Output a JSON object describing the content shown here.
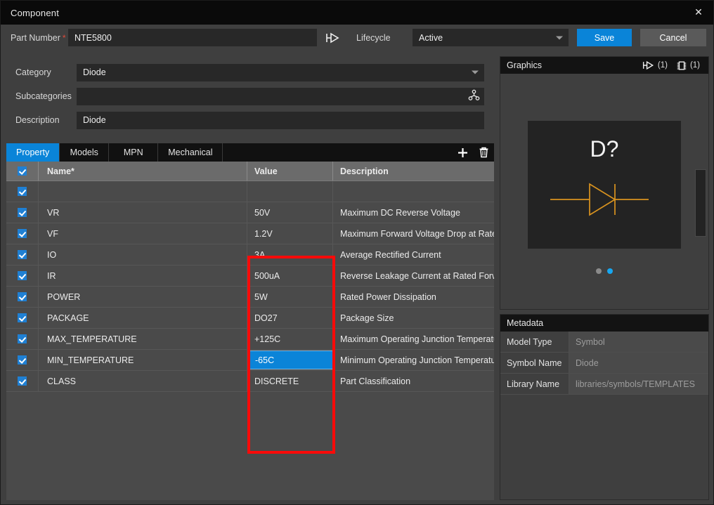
{
  "window": {
    "title": "Component",
    "close_label": "✕"
  },
  "header": {
    "part_number_label": "Part Number",
    "part_number_required": "*",
    "part_number_value": "NTE5800",
    "pin_icon": "pin-symbol-icon",
    "lifecycle_label": "Lifecycle",
    "lifecycle_value": "Active",
    "save_label": "Save",
    "cancel_label": "Cancel",
    "accent_color": "#0a84d8"
  },
  "form": {
    "category_label": "Category",
    "category_value": "Diode",
    "subcategories_label": "Subcategories",
    "subcategories_value": "",
    "subcategories_icon": "hierarchy-tree-icon",
    "description_label": "Description",
    "description_value": "Diode"
  },
  "tabs": {
    "items": [
      {
        "label": "Property",
        "active": true
      },
      {
        "label": "Models",
        "active": false
      },
      {
        "label": "MPN",
        "active": false
      },
      {
        "label": "Mechanical",
        "active": false
      }
    ],
    "add_icon": "plus-icon",
    "delete_icon": "trash-icon"
  },
  "table": {
    "columns": [
      "Name*",
      "Value",
      "Description"
    ],
    "header_checked": true,
    "rows": [
      {
        "checked": true,
        "name": "",
        "value": "",
        "description": "",
        "selected": false
      },
      {
        "checked": true,
        "name": "VR",
        "value": "50V",
        "description": "Maximum DC Reverse Voltage",
        "selected": false
      },
      {
        "checked": true,
        "name": "VF",
        "value": "1.2V",
        "description": "Maximum Forward Voltage Drop at Rated Current",
        "selected": false
      },
      {
        "checked": true,
        "name": "IO",
        "value": "3A",
        "description": "Average Rectified Current",
        "selected": false
      },
      {
        "checked": true,
        "name": "IR",
        "value": "500uA",
        "description": "Reverse Leakage Current at Rated Forward Voltage",
        "selected": false
      },
      {
        "checked": true,
        "name": "POWER",
        "value": "5W",
        "description": "Rated Power Dissipation",
        "selected": false
      },
      {
        "checked": true,
        "name": "PACKAGE",
        "value": "DO27",
        "description": "Package Size",
        "selected": false
      },
      {
        "checked": true,
        "name": "MAX_TEMPERATURE",
        "value": "+125C",
        "description": "Maximum Operating Junction Temperature",
        "selected": false
      },
      {
        "checked": true,
        "name": "MIN_TEMPERATURE",
        "value": "-65C",
        "description": "Minimum Operating Junction Temperature",
        "selected": true
      },
      {
        "checked": true,
        "name": "CLASS",
        "value": "DISCRETE",
        "description": "Part Classification",
        "selected": false
      }
    ],
    "highlight_color": "#fb0a09",
    "selection_color": "#0b84d8"
  },
  "graphics": {
    "title": "Graphics",
    "symbol_icon": "pin-symbol-icon",
    "symbol_count": "(1)",
    "footprint_icon": "ic-footprint-icon",
    "footprint_count": "(1)",
    "preview_reference": "D?",
    "preview_symbol": "diode-symbol",
    "symbol_color": "#d9931f",
    "page_dots": [
      {
        "active": false
      },
      {
        "active": true
      }
    ]
  },
  "metadata": {
    "title": "Metadata",
    "rows": [
      {
        "key": "Model Type",
        "value": "Symbol"
      },
      {
        "key": "Symbol Name",
        "value": "Diode"
      },
      {
        "key": "Library Name",
        "value": "libraries/symbols/TEMPLATES"
      }
    ]
  }
}
